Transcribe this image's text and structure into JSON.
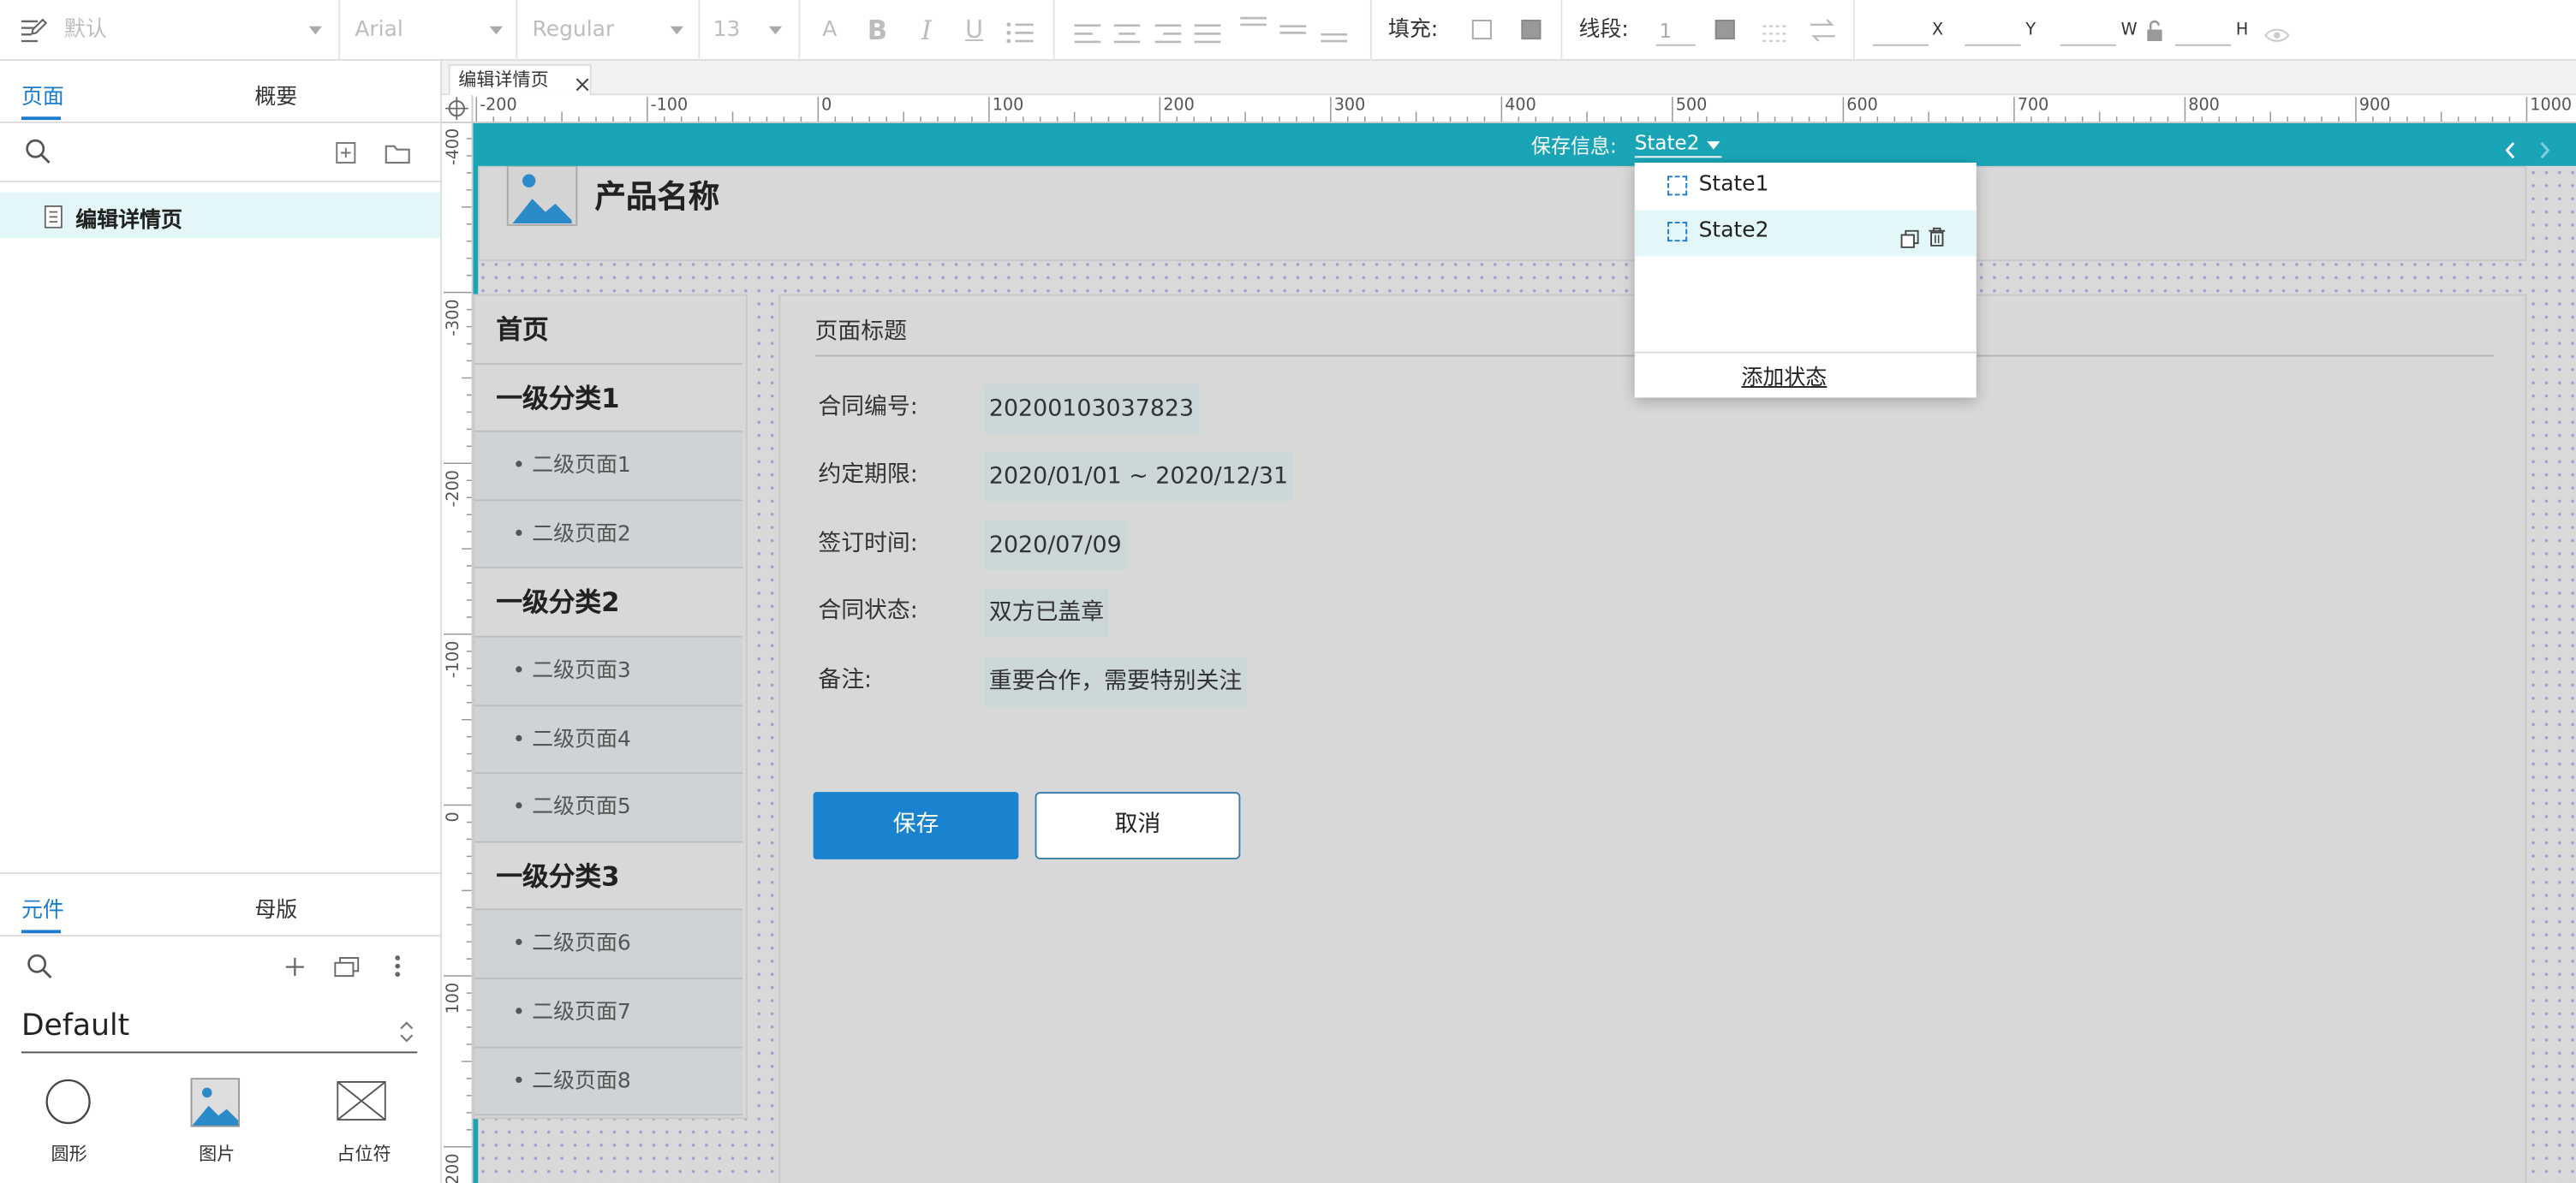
{
  "toolbar": {
    "style_value": "默认",
    "font_family": "Arial",
    "font_weight": "Regular",
    "font_size": "13",
    "fill_label": "填充:",
    "stroke_label": "线段:",
    "stroke_width": "1",
    "axis_x": "X",
    "axis_y": "Y",
    "axis_w": "W",
    "axis_h": "H"
  },
  "pages_panel": {
    "tabs": [
      "页面",
      "概要"
    ],
    "page_item": "编辑详情页"
  },
  "components_panel": {
    "tabs": [
      "元件",
      "母版"
    ],
    "library": "Default",
    "items": [
      "圆形",
      "图片",
      "占位符"
    ]
  },
  "canvas_tab": {
    "label": "编辑详情页"
  },
  "rulers": {
    "h_ticks": [
      "-200",
      "-100",
      "0",
      "100",
      "200",
      "300",
      "400",
      "500",
      "600",
      "700",
      "800",
      "900",
      "1000"
    ],
    "v_ticks": [
      "-400",
      "-300",
      "-200",
      "-100",
      "0",
      "100",
      "200"
    ]
  },
  "state_bar": {
    "label": "保存信息:",
    "current": "State2"
  },
  "state_dropdown": {
    "states": [
      "State1",
      "State2"
    ],
    "selected_index": 1,
    "add_label": "添加状态"
  },
  "design": {
    "product_name": "产品名称",
    "nav": [
      {
        "level": 1,
        "label": "首页"
      },
      {
        "level": 1,
        "label": "一级分类1"
      },
      {
        "level": 2,
        "label": "• 二级页面1"
      },
      {
        "level": 2,
        "label": "• 二级页面2"
      },
      {
        "level": 1,
        "label": "一级分类2"
      },
      {
        "level": 2,
        "label": "• 二级页面3"
      },
      {
        "level": 2,
        "label": "• 二级页面4"
      },
      {
        "level": 2,
        "label": "• 二级页面5"
      },
      {
        "level": 1,
        "label": "一级分类3"
      },
      {
        "level": 2,
        "label": "• 二级页面6"
      },
      {
        "level": 2,
        "label": "• 二级页面7"
      },
      {
        "level": 2,
        "label": "• 二级页面8"
      }
    ],
    "page_title": "页面标题",
    "fields": [
      {
        "label": "合同编号:",
        "value": "20200103037823"
      },
      {
        "label": "约定期限:",
        "value": "2020/01/01 ~ 2020/12/31"
      },
      {
        "label": "签订时间:",
        "value": "2020/07/09"
      },
      {
        "label": "合同状态:",
        "value": "双方已盖章"
      },
      {
        "label": "备注:",
        "value": "重要合作，需要特别关注"
      }
    ],
    "save_button": "保存",
    "cancel_button": "取消"
  }
}
